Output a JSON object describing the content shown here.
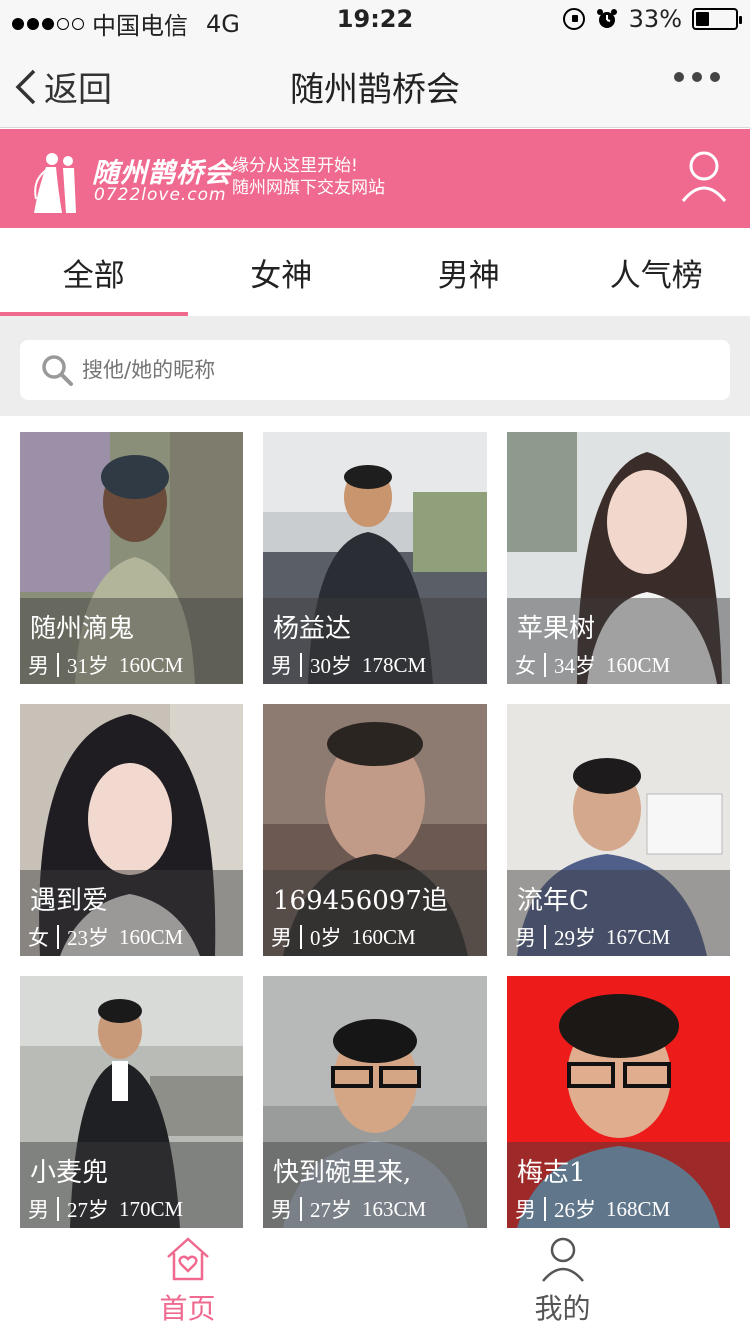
{
  "status_bar": {
    "carrier": "中国电信",
    "network": "4G",
    "time": "19:22",
    "battery": "33%",
    "battery_level": 0.33
  },
  "nav": {
    "back_label": "返回",
    "title": "随州鹊桥会"
  },
  "banner": {
    "logo_title": "随州鹊桥会",
    "logo_url": "0722love.com",
    "slogan_line1": "缘分从这里开始!",
    "slogan_line2": "随州网旗下交友网站"
  },
  "tabs": [
    {
      "label": "全部",
      "active": true
    },
    {
      "label": "女神",
      "active": false
    },
    {
      "label": "男神",
      "active": false
    },
    {
      "label": "人气榜",
      "active": false
    }
  ],
  "search": {
    "placeholder": "搜他/她的昵称"
  },
  "profiles": [
    {
      "nickname": "随州滴鬼",
      "gender": "男",
      "age": "31岁",
      "height": "160CM"
    },
    {
      "nickname": "杨益达",
      "gender": "男",
      "age": "30岁",
      "height": "178CM"
    },
    {
      "nickname": "苹果树",
      "gender": "女",
      "age": "34岁",
      "height": "160CM"
    },
    {
      "nickname": "遇到爱",
      "gender": "女",
      "age": "23岁",
      "height": "160CM"
    },
    {
      "nickname": "169456097追",
      "gender": "男",
      "age": "0岁",
      "height": "160CM"
    },
    {
      "nickname": "流年C",
      "gender": "男",
      "age": "29岁",
      "height": "167CM"
    },
    {
      "nickname": "小麦兜",
      "gender": "男",
      "age": "27岁",
      "height": "170CM"
    },
    {
      "nickname": "快到碗里来,",
      "gender": "男",
      "age": "27岁",
      "height": "163CM"
    },
    {
      "nickname": "梅志1",
      "gender": "男",
      "age": "26岁",
      "height": "168CM"
    }
  ],
  "bottom_tabs": [
    {
      "label": "首页",
      "icon": "home-heart-icon",
      "active": true
    },
    {
      "label": "我的",
      "icon": "person-icon",
      "active": false
    }
  ],
  "colors": {
    "brand_pink": "#ef6a8e",
    "background_gray": "#ededed",
    "bar_gray": "#f7f7f7"
  }
}
